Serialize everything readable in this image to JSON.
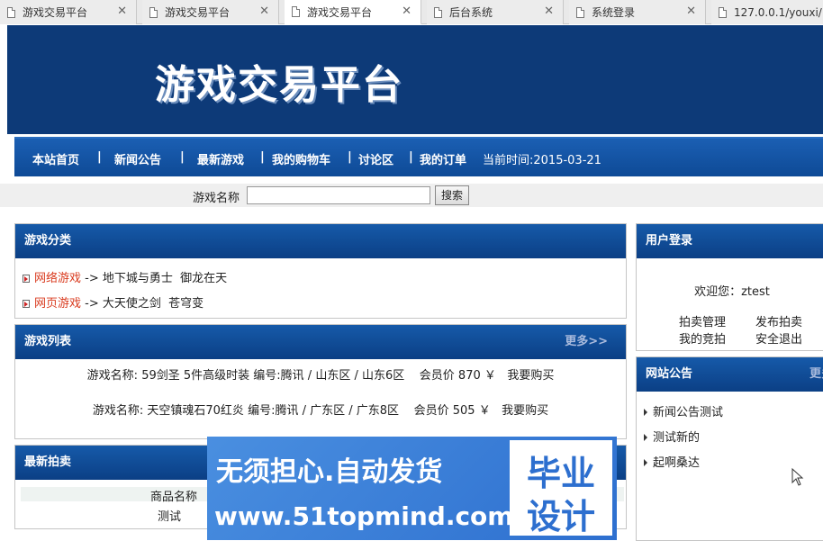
{
  "browser": {
    "tabs": [
      {
        "label": "游戏交易平台",
        "active": false
      },
      {
        "label": "游戏交易平台",
        "active": false
      },
      {
        "label": "游戏交易平台",
        "active": true
      },
      {
        "label": "后台系统",
        "active": false
      },
      {
        "label": "系统登录",
        "active": false
      },
      {
        "label": "127.0.0.1/youxi/",
        "active": false
      }
    ]
  },
  "header": {
    "title": "游戏交易平台"
  },
  "nav": {
    "items": [
      "本站首页",
      "新闻公告",
      "最新游戏",
      "我的购物车",
      "讨论区",
      "我的订单"
    ],
    "separator": "|",
    "time": "当前时间:2015-03-21"
  },
  "search": {
    "label": "游戏名称",
    "value": "",
    "button": "搜索"
  },
  "categories": {
    "title": "游戏分类",
    "rows": [
      {
        "name": "网络游戏",
        "arrow": "->",
        "games": "地下城与勇士  御龙在天"
      },
      {
        "name": "网页游戏",
        "arrow": "->",
        "games": "大天使之剑  苍穹变"
      }
    ]
  },
  "game_list": {
    "title": "游戏列表",
    "more": "更多>>",
    "rows": [
      {
        "name_label": "游戏名称:",
        "name": "59剑圣 5件高级时装",
        "code_label": "编号:",
        "code": "腾讯 / 山东区 / 山东6区",
        "price_label": "会员价",
        "price": "870",
        "currency": "￥",
        "buy": "我要购买"
      },
      {
        "name_label": "游戏名称:",
        "name": "天空镇魂石70红炎",
        "code_label": "编号:",
        "code": "腾讯 / 广东区 / 广东8区",
        "price_label": "会员价",
        "price": "505",
        "currency": "￥",
        "buy": "我要购买"
      }
    ]
  },
  "auction": {
    "title": "最新拍卖",
    "column": "商品名称",
    "items": [
      "测试"
    ]
  },
  "login": {
    "title": "用户登录",
    "welcome": "欢迎您：ztest",
    "links": [
      "拍卖管理",
      "发布拍卖",
      "我的竞拍",
      "安全退出"
    ]
  },
  "notice": {
    "title": "网站公告",
    "more": "更多",
    "items": [
      "新闻公告测试",
      "测试新的",
      "起啊桑达"
    ]
  },
  "watermark": {
    "line1": "无须担心.自动发货",
    "line2": "www.51topmind.com",
    "box_line1": "毕业",
    "box_line2": "设计"
  }
}
